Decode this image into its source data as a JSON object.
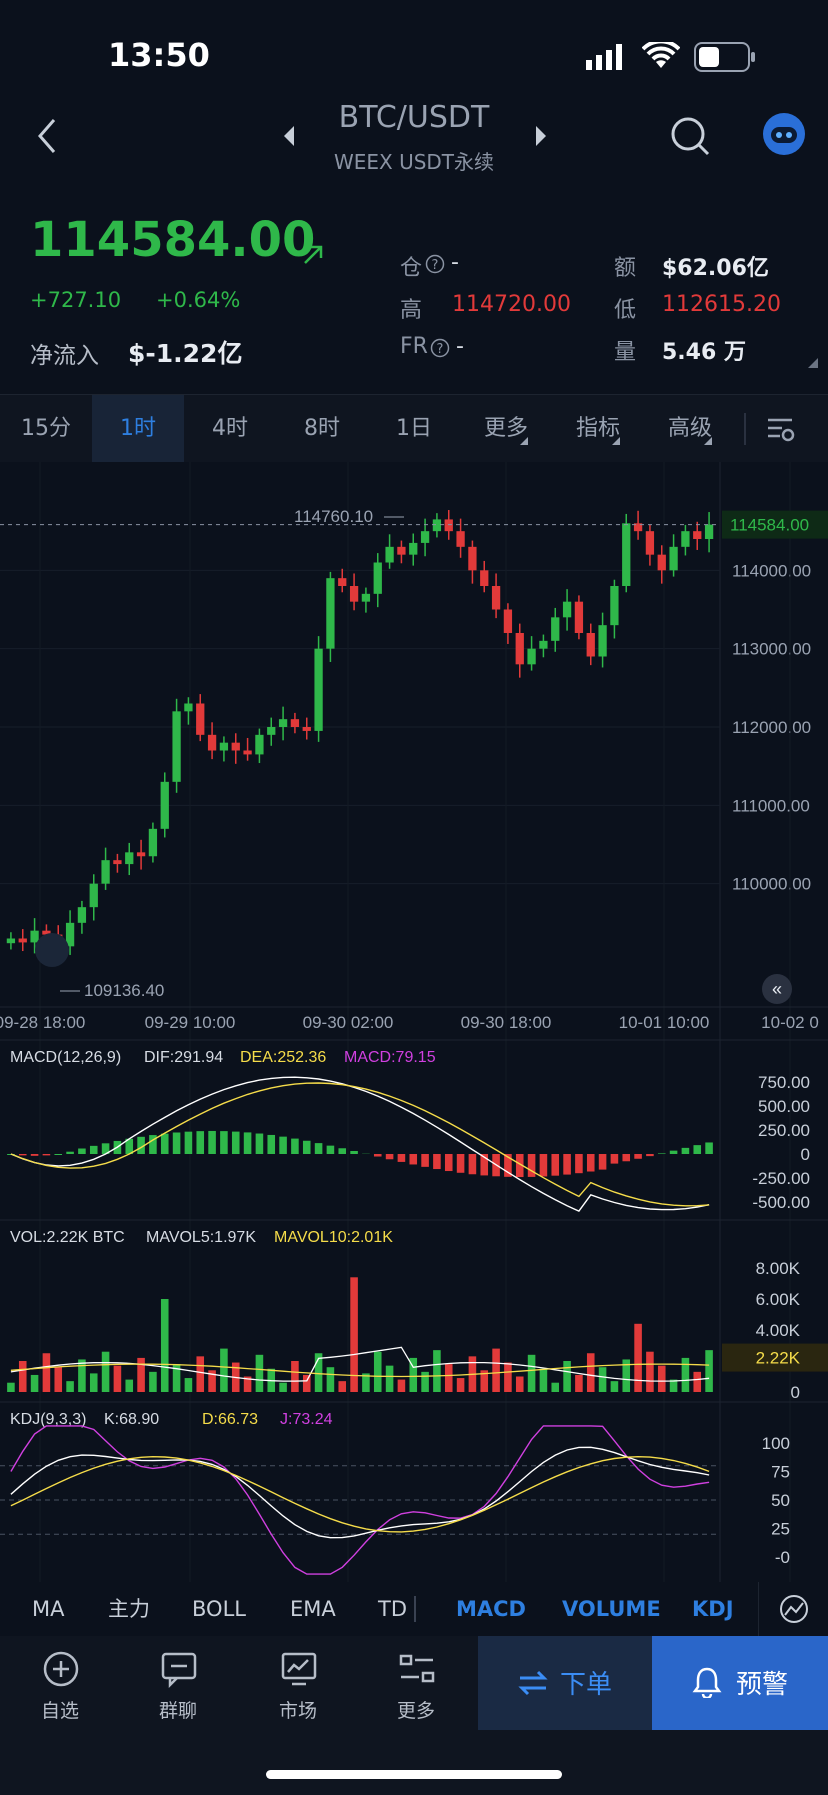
{
  "status": {
    "time": "13:50"
  },
  "header": {
    "pair": "BTC/USDT",
    "exchange": "WEEX USDT永续"
  },
  "ticker": {
    "price": "114584.00",
    "change_abs": "+727.10",
    "change_pct": "+0.64%",
    "netflow_label": "净流入",
    "netflow_value": "$-1.22亿",
    "oi_label": "仓",
    "oi_value": "-",
    "high_label": "高",
    "high_value": "114720.00",
    "fr_label": "FR",
    "fr_value": "-",
    "amount_label": "额",
    "amount_value": "$62.06亿",
    "low_label": "低",
    "low_value": "112615.20",
    "volume_label": "量",
    "volume_value": "5.46 万"
  },
  "tabs": [
    "15分",
    "1时",
    "4时",
    "8时",
    "1日",
    "更多",
    "指标",
    "高级"
  ],
  "active_tab": "1时",
  "chart": {
    "price_ticks": [
      "114000.00",
      "113000.00",
      "112000.00",
      "111000.00",
      "110000.00"
    ],
    "current_price_tag": "114584.00",
    "max_label": "114760.10",
    "min_label": "109136.40",
    "time_labels": [
      "09-28 18:00",
      "09-29 10:00",
      "09-30 02:00",
      "09-30 18:00",
      "10-01 10:00",
      "10-02 0"
    ],
    "macd_header": {
      "name": "MACD(12,26,9)",
      "dif": "DIF:291.94",
      "dea": "DEA:252.36",
      "macd": "MACD:79.15"
    },
    "macd_ticks": [
      "750.00",
      "500.00",
      "250.00",
      "0",
      "-250.00",
      "-500.00"
    ],
    "vol_header": {
      "name": "VOL:2.22K BTC",
      "ma5": "MAVOL5:1.97K",
      "ma10": "MAVOL10:2.01K"
    },
    "vol_ticks": [
      "8.00K",
      "6.00K",
      "4.00K",
      "2.22K",
      "0"
    ],
    "kdj_header": {
      "name": "KDJ(9,3,3)",
      "k": "K:68.90",
      "d": "D:66.73",
      "j": "J:73.24"
    },
    "kdj_ticks": [
      "100",
      "75",
      "50",
      "25",
      "-0"
    ]
  },
  "indicators": [
    "MA",
    "主力",
    "BOLL",
    "EMA",
    "TD",
    "MACD",
    "VOLUME",
    "KDJ"
  ],
  "bottom_nav": [
    "自选",
    "群聊",
    "市场",
    "更多"
  ],
  "actions": {
    "order": "下单",
    "alert": "预警"
  },
  "colors": {
    "up": "#2fb84a",
    "down": "#e23a3a",
    "accent": "#2e7fe0"
  },
  "chart_data": {
    "type": "candlestick",
    "timeframe": "1时",
    "x_labels": [
      "09-28 18:00",
      "09-29 10:00",
      "09-30 02:00",
      "09-30 18:00",
      "10-01 10:00"
    ],
    "closes": [
      109300,
      109250,
      109400,
      109350,
      109200,
      109500,
      109700,
      110000,
      110300,
      110250,
      110400,
      110350,
      110700,
      111300,
      112200,
      112300,
      111900,
      111700,
      111800,
      111700,
      111650,
      111900,
      112000,
      112100,
      112000,
      111950,
      113000,
      113900,
      113800,
      113600,
      113700,
      114100,
      114300,
      114200,
      114350,
      114500,
      114650,
      114500,
      114300,
      114000,
      113800,
      113500,
      113200,
      112800,
      113000,
      113100,
      113400,
      113600,
      113200,
      112900,
      113300,
      113800,
      114600,
      114500,
      114200,
      114000,
      114300,
      114500,
      114400,
      114584
    ],
    "ylim": [
      109000,
      115000
    ],
    "macd": {
      "dif": 291.94,
      "dea": 252.36,
      "hist": 79.15
    },
    "volume": {
      "last": "2.22K",
      "mavol5": "1.97K",
      "mavol10": "2.01K"
    },
    "kdj": {
      "k": 68.9,
      "d": 66.73,
      "j": 73.24
    }
  }
}
